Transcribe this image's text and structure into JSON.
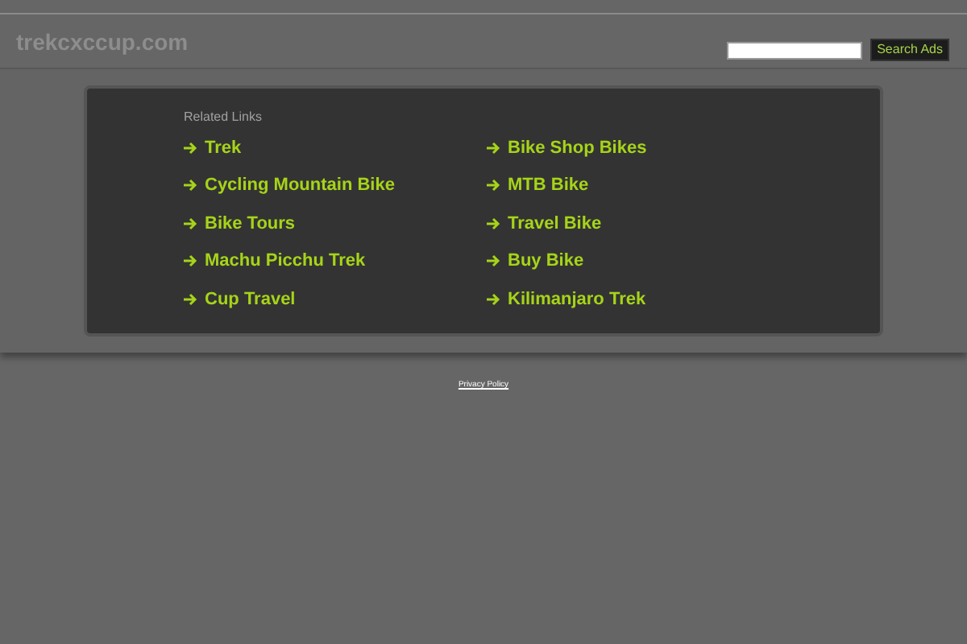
{
  "site_title": "trekcxccup.com",
  "search": {
    "button": "Search Ads"
  },
  "related_links": {
    "heading": "Related Links",
    "links": [
      {
        "label": "Trek"
      },
      {
        "label": "Bike Shop Bikes"
      },
      {
        "label": "Cycling Mountain Bike"
      },
      {
        "label": "MTB Bike"
      },
      {
        "label": "Bike Tours"
      },
      {
        "label": "Travel Bike"
      },
      {
        "label": "Machu Picchu Trek"
      },
      {
        "label": "Buy Bike"
      },
      {
        "label": "Cup Travel"
      },
      {
        "label": "Kilimanjaro Trek"
      }
    ]
  },
  "footer": {
    "link": "Privacy Policy"
  }
}
